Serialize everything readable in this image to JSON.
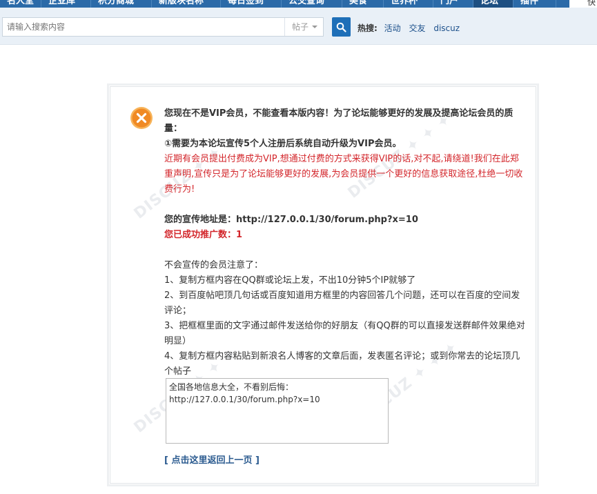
{
  "nav": {
    "items": [
      {
        "label": "名人堂",
        "active": false
      },
      {
        "label": "企业库",
        "active": false
      },
      {
        "label": "积分商城",
        "active": false
      },
      {
        "label": "新版块名称",
        "active": false
      },
      {
        "label": "每日签到",
        "active": false
      },
      {
        "label": "公交查询",
        "active": false
      },
      {
        "label": "美食",
        "active": false
      },
      {
        "label": "世界杯",
        "active": false
      },
      {
        "label": "门户",
        "active": false
      },
      {
        "label": "论坛",
        "active": true
      },
      {
        "label": "插件",
        "active": false
      }
    ],
    "right_text": "快"
  },
  "search": {
    "placeholder": "请输入搜索内容",
    "type_label": "帖子",
    "hot_label": "热搜:",
    "hot_links": [
      "活动",
      "交友",
      "discuz"
    ]
  },
  "message": {
    "line1": "您现在不是VIP会员，不能查看本版内容！为了论坛能够更好的发展及提高论坛会员的质量：",
    "line2": "①需要为本论坛宣传5个人注册后系统自动升级为VIP会员。",
    "warning": "近期有会员提出付费成为VIP,想通过付费的方式来获得VIP的话,对不起,请绕道!我们在此郑重声明,宣传只是为了论坛能够更好的发展,为会员提供一个更好的信息获取途径,杜绝一切收费行为!",
    "promo_address": "您的宣传地址是：http://127.0.0.1/30/forum.php?x=10",
    "promo_count": "您已成功推广数：1",
    "tips_title": "不会宣传的会员注意了：",
    "tip1": "1、复制方框内容在QQ群或论坛上发，不出10分钟5个IP就够了",
    "tip2": "2、到百度帖吧顶几句话或百度知道用方框里的内容回答几个问题，还可以在百度的空间发评论；",
    "tip3": "3、把框框里面的文字通过邮件发送给你的好朋友（有QQ群的可以直接发送群邮件效果绝对明显）",
    "tip4": "4、复制方框内容粘贴到新浪名人博客的文章后面，发表匿名评论；或到你常去的论坛顶几个帖子",
    "copy_line1": "全国各地信息大全，不看别后悔：",
    "copy_line2": "http://127.0.0.1/30/forum.php?x=10",
    "back_link": "[ 点击这里返回上一页 ]"
  },
  "colors": {
    "nav_bg": "#2b6aa8",
    "search_bg": "#e9f0f7",
    "search_btn": "#1e6fb8",
    "alert_orange": "#f08a24",
    "warning_red": "#d3262b",
    "link_blue": "#2a5a8f"
  }
}
